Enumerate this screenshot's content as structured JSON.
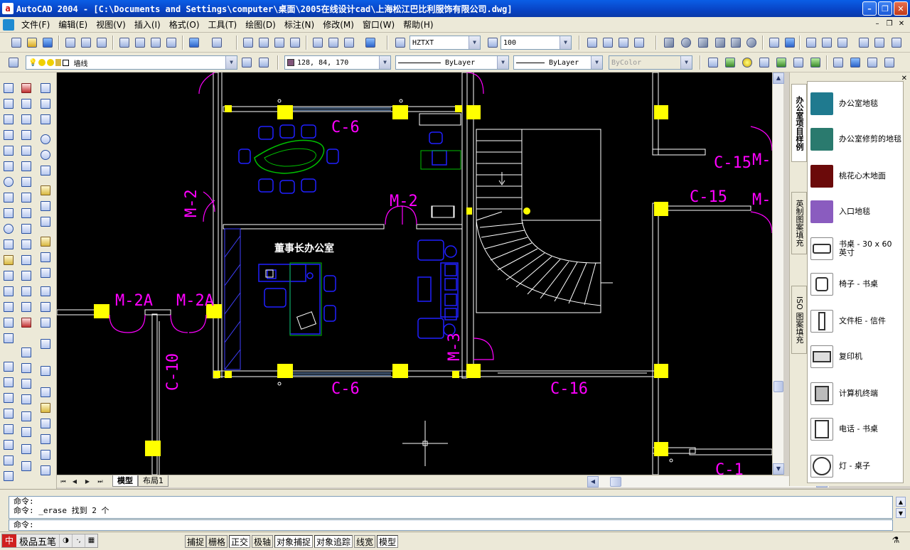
{
  "window": {
    "app_letter": "a",
    "title": "AutoCAD 2004 - [C:\\Documents and Settings\\computer\\桌面\\2005在线设计cad\\上海松江巴比利服饰有限公司.dwg]",
    "minimize": "–",
    "maximize": "❐",
    "close": "✕"
  },
  "menu": {
    "items": [
      "文件(F)",
      "编辑(E)",
      "视图(V)",
      "插入(I)",
      "格式(O)",
      "工具(T)",
      "绘图(D)",
      "标注(N)",
      "修改(M)",
      "窗口(W)",
      "帮助(H)"
    ],
    "doc_buttons": [
      "–",
      "❐",
      "✕"
    ]
  },
  "toolbar1": {
    "text_style": "HZTXT",
    "dim_scale": "100"
  },
  "toolbar2": {
    "layer_name": "墙线",
    "color_value": "128, 84, 170",
    "linetype": "ByLayer",
    "lineweight": "ByLayer",
    "plot_style": "ByColor"
  },
  "drawing": {
    "labels": {
      "c6_top": "C-6",
      "c6_bottom": "C-6",
      "c15_a": "C-15",
      "c15_b": "C-15",
      "m_a": "M-",
      "m_b": "M-",
      "m2_left": "M-2",
      "m2_center": "M-2",
      "m2a_left": "M-2A",
      "m2a_right": "M-2A",
      "c10": "C-10",
      "m3": "M-3",
      "c16": "C-16",
      "c1": "C-1",
      "room_name": "董事长办公室"
    }
  },
  "layout_tabs": {
    "nav": [
      "⏮",
      "◀",
      "▶",
      "⏭"
    ],
    "tabs": [
      "模型",
      "布局1"
    ]
  },
  "palette": {
    "close": "✕",
    "tabs": [
      "办公室项目样例",
      "英制图案填充",
      "ISO 图案填充"
    ],
    "items": [
      {
        "label": "办公室地毯",
        "color": "#1f7a8f"
      },
      {
        "label": "办公室修剪的地毯",
        "color": "#2a7a6e"
      },
      {
        "label": "桃花心木地面",
        "color": "#6b0a0a"
      },
      {
        "label": "入口地毯",
        "color": "#8a5cbf"
      },
      {
        "label": "书桌 - 30 x 60 英寸",
        "icon": "desk-icon"
      },
      {
        "label": "椅子 - 书桌",
        "icon": "chair-icon"
      },
      {
        "label": "文件柜 - 信件",
        "icon": "file-cabinet-icon"
      },
      {
        "label": "复印机",
        "icon": "copier-icon"
      },
      {
        "label": "计算机终端",
        "icon": "computer-icon"
      },
      {
        "label": "电话 - 书桌",
        "icon": "phone-icon"
      },
      {
        "label": "灯 - 桌子",
        "icon": "lamp-icon"
      }
    ]
  },
  "command": {
    "history_lines": [
      "命令:",
      "命令: _erase 找到 2 个"
    ],
    "prompt": "命令:"
  },
  "statusbar": {
    "ime_name": "极品五笔",
    "ime_logo": "中",
    "ime_parts": [
      "◑",
      "·,",
      "▦"
    ],
    "toggles": [
      {
        "label": "捕捉",
        "on": false
      },
      {
        "label": "栅格",
        "on": false
      },
      {
        "label": "正交",
        "on": true
      },
      {
        "label": "极轴",
        "on": false
      },
      {
        "label": "对象捕捉",
        "on": true
      },
      {
        "label": "对象追踪",
        "on": true
      },
      {
        "label": "线宽",
        "on": false
      },
      {
        "label": "模型",
        "on": true
      }
    ],
    "tray": "⚗"
  },
  "colors": {
    "magenta": "#ff00ff",
    "blue": "#0000ff",
    "green": "#00c000",
    "yellow": "#ffff00",
    "white": "#ffffff"
  }
}
